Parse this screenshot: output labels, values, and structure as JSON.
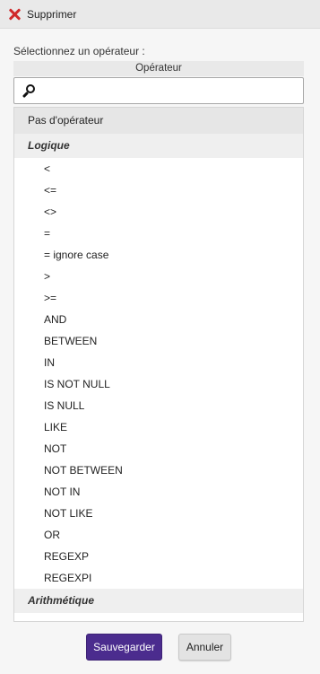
{
  "topbar": {
    "close_label": "Supprimer"
  },
  "prompt": "Sélectionnez un opérateur :",
  "panel_title": "Opérateur",
  "search": {
    "value": "",
    "placeholder": ""
  },
  "no_operator": "Pas d'opérateur",
  "groups": {
    "logique": "Logique",
    "arithmetique": "Arithmétique"
  },
  "logique_items": [
    "<",
    "<=",
    "<>",
    "=",
    "= ignore case",
    ">",
    ">=",
    "AND",
    "BETWEEN",
    "IN",
    "IS NOT NULL",
    "IS NULL",
    "LIKE",
    "NOT",
    "NOT BETWEEN",
    "NOT IN",
    "NOT LIKE",
    "OR",
    "REGEXP",
    "REGEXPI"
  ],
  "buttons": {
    "save": "Sauvegarder",
    "cancel": "Annuler"
  },
  "colors": {
    "accent": "#4b2c8e",
    "close_icon": "#d0292a"
  },
  "icons": [
    "close-icon",
    "search-icon"
  ]
}
